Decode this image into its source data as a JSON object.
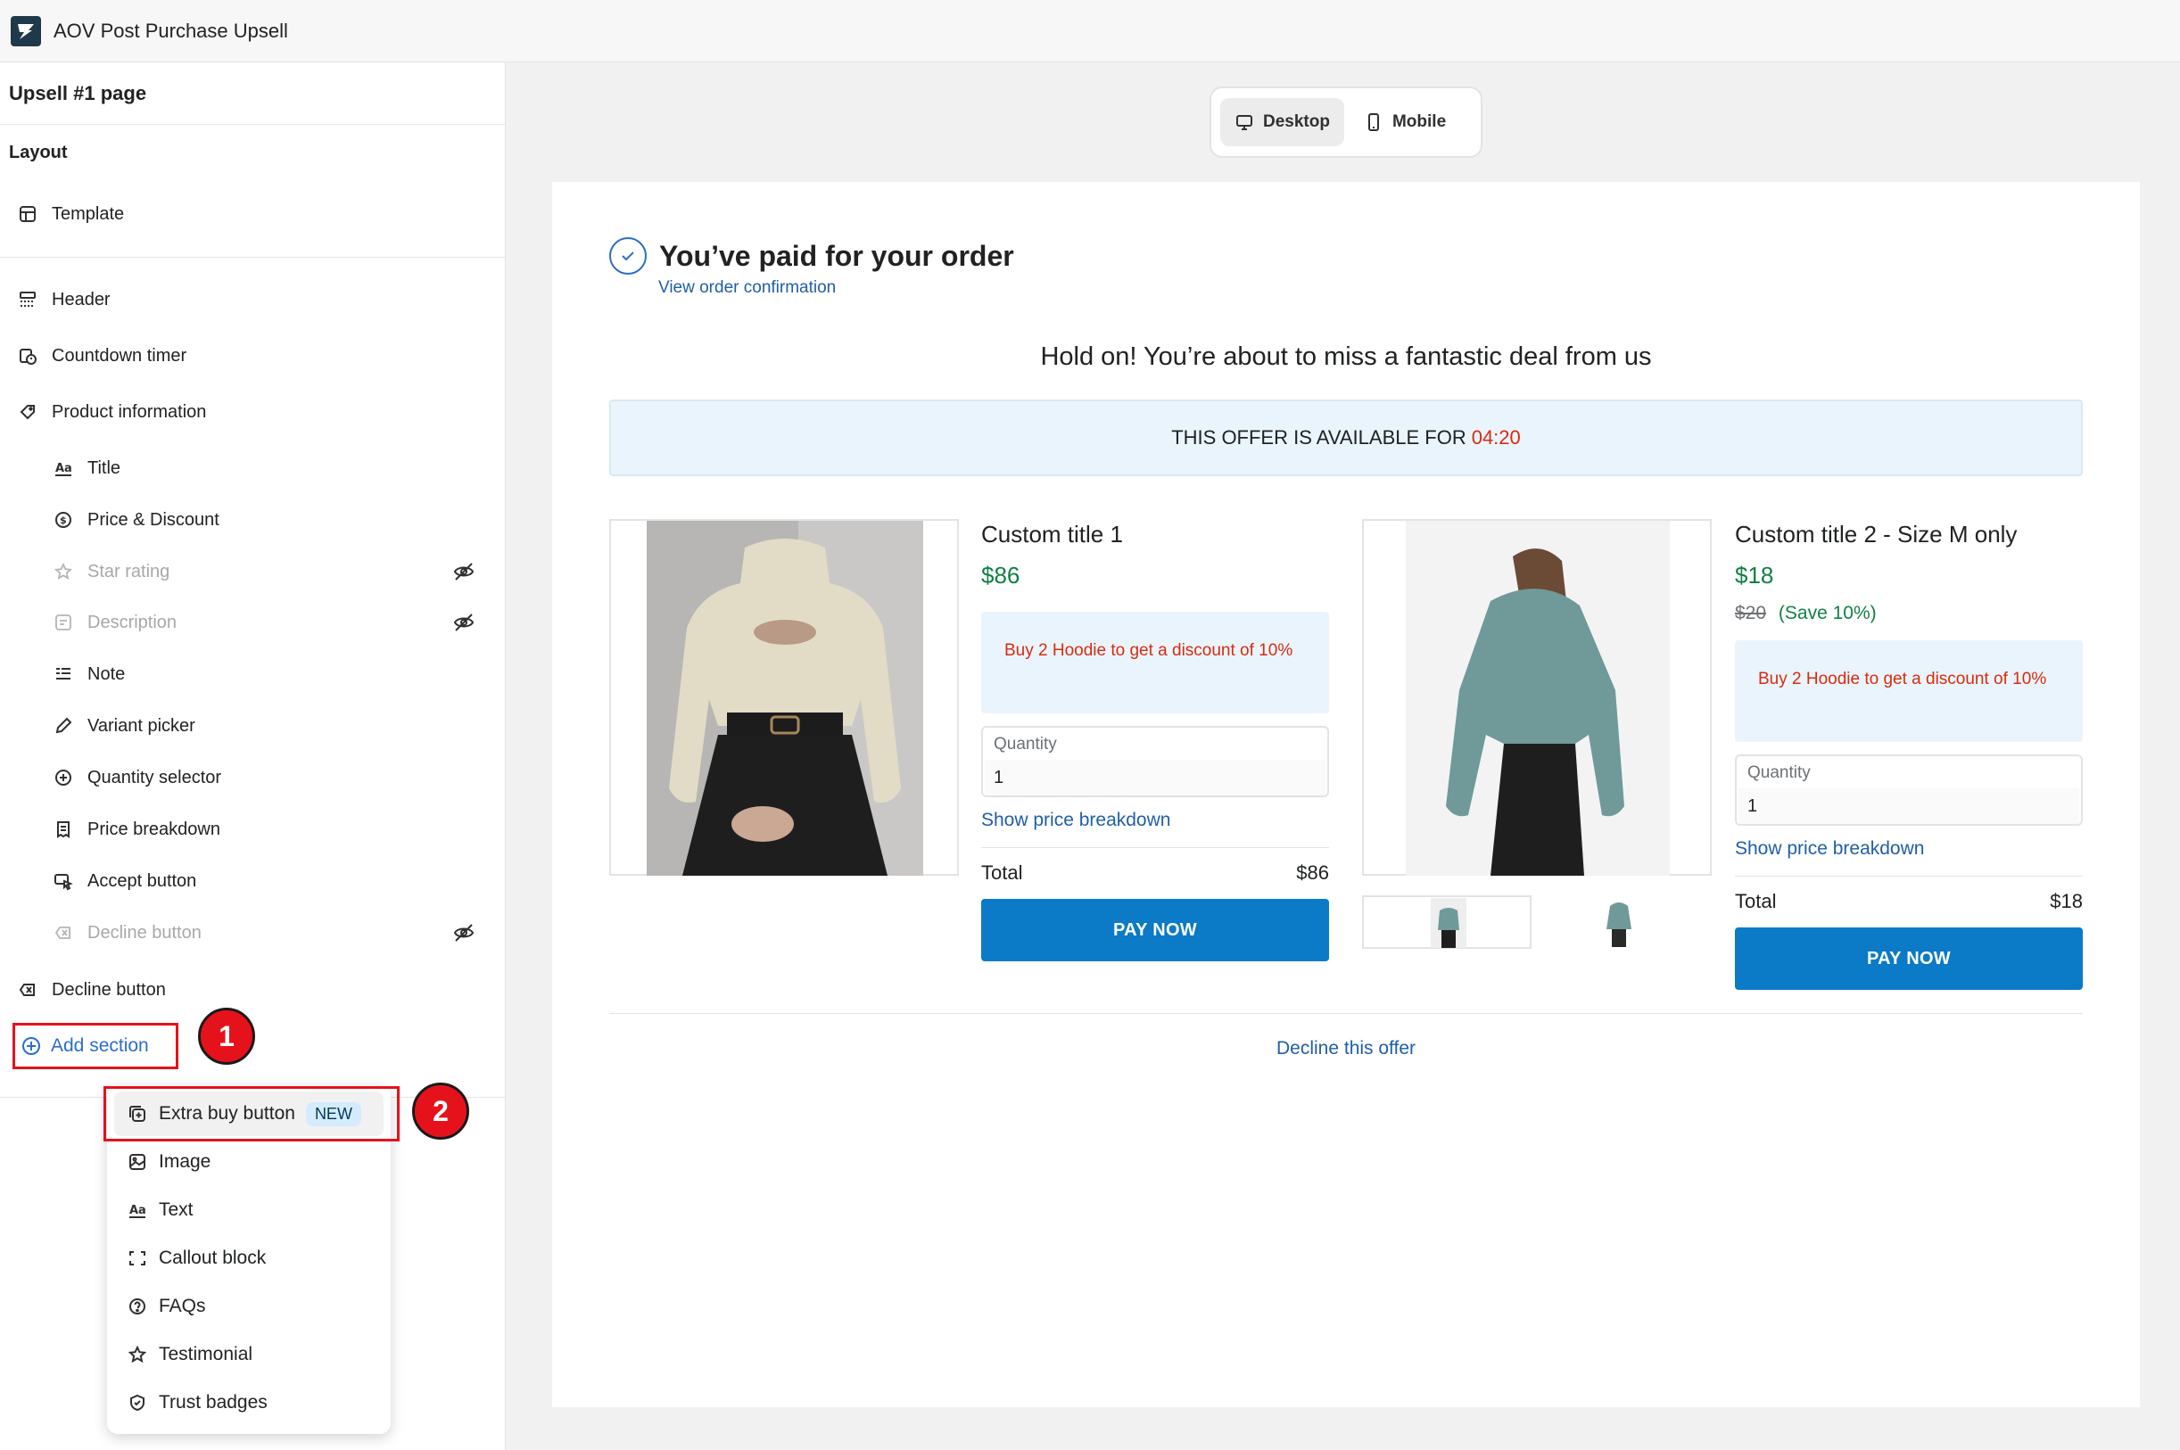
{
  "app": {
    "title": "AOV Post Purchase Upsell"
  },
  "sidebar": {
    "page_title": "Upsell #1 page",
    "layout_title": "Layout",
    "template_label": "Template",
    "sections": [
      {
        "label": "Header",
        "icon": "header-icon"
      },
      {
        "label": "Countdown timer",
        "icon": "timer-icon"
      },
      {
        "label": "Product information",
        "icon": "tag-icon"
      }
    ],
    "product_blocks": [
      {
        "label": "Title",
        "icon": "text-icon",
        "hidden": false
      },
      {
        "label": "Price & Discount",
        "icon": "dollar-icon",
        "hidden": false
      },
      {
        "label": "Star rating",
        "icon": "star-icon",
        "hidden": true
      },
      {
        "label": "Description",
        "icon": "description-icon",
        "hidden": true
      },
      {
        "label": "Note",
        "icon": "note-icon",
        "hidden": false
      },
      {
        "label": "Variant picker",
        "icon": "pencil-icon",
        "hidden": false
      },
      {
        "label": "Quantity selector",
        "icon": "plus-circle-icon",
        "hidden": false
      },
      {
        "label": "Price breakdown",
        "icon": "receipt-icon",
        "hidden": false
      },
      {
        "label": "Accept button",
        "icon": "cursor-icon",
        "hidden": false
      },
      {
        "label": "Decline button",
        "icon": "x-box-icon",
        "hidden": true
      }
    ],
    "decline_section": "Decline button",
    "add_section": "Add section"
  },
  "callouts": {
    "one": "1",
    "two": "2"
  },
  "dropdown": {
    "items": [
      {
        "label": "Extra buy button",
        "badge": "NEW",
        "icon": "duplicate-icon"
      },
      {
        "label": "Image",
        "icon": "image-icon"
      },
      {
        "label": "Text",
        "icon": "text-icon"
      },
      {
        "label": "Callout block",
        "icon": "frame-icon"
      },
      {
        "label": "FAQs",
        "icon": "question-icon"
      },
      {
        "label": "Testimonial",
        "icon": "star-icon"
      },
      {
        "label": "Trust badges",
        "icon": "shield-icon"
      }
    ]
  },
  "view_toggle": {
    "desktop": "Desktop",
    "mobile": "Mobile",
    "active": "desktop"
  },
  "preview": {
    "paid_title": "You’ve paid for your order",
    "order_link": "View order confirmation",
    "hold_text": "Hold on! You’re about to miss a fantastic deal from us",
    "offer_text": "THIS OFFER IS AVAILABLE FOR",
    "offer_time": "04:20",
    "products": [
      {
        "title": "Custom title 1",
        "price": "$86",
        "note": "Buy 2 Hoodie to get a discount of 10%",
        "qty_label": "Quantity",
        "qty_value": "1",
        "breakdown": "Show price breakdown",
        "total_label": "Total",
        "total_value": "$86",
        "button": "PAY NOW"
      },
      {
        "title": "Custom title 2 - Size M only",
        "price": "$18",
        "compare_price": "$20",
        "save_text": "(Save 10%)",
        "note": "Buy 2 Hoodie to get a discount of 10%",
        "qty_label": "Quantity",
        "qty_value": "1",
        "breakdown": "Show price breakdown",
        "total_label": "Total",
        "total_value": "$18",
        "button": "PAY NOW"
      }
    ],
    "decline": "Decline this offer"
  },
  "colors": {
    "accent": "#2c6ecb",
    "pay_button": "#0b7ac7",
    "price_green": "#108043",
    "note_red": "#d72c0d",
    "callout_red": "#e5121b"
  }
}
